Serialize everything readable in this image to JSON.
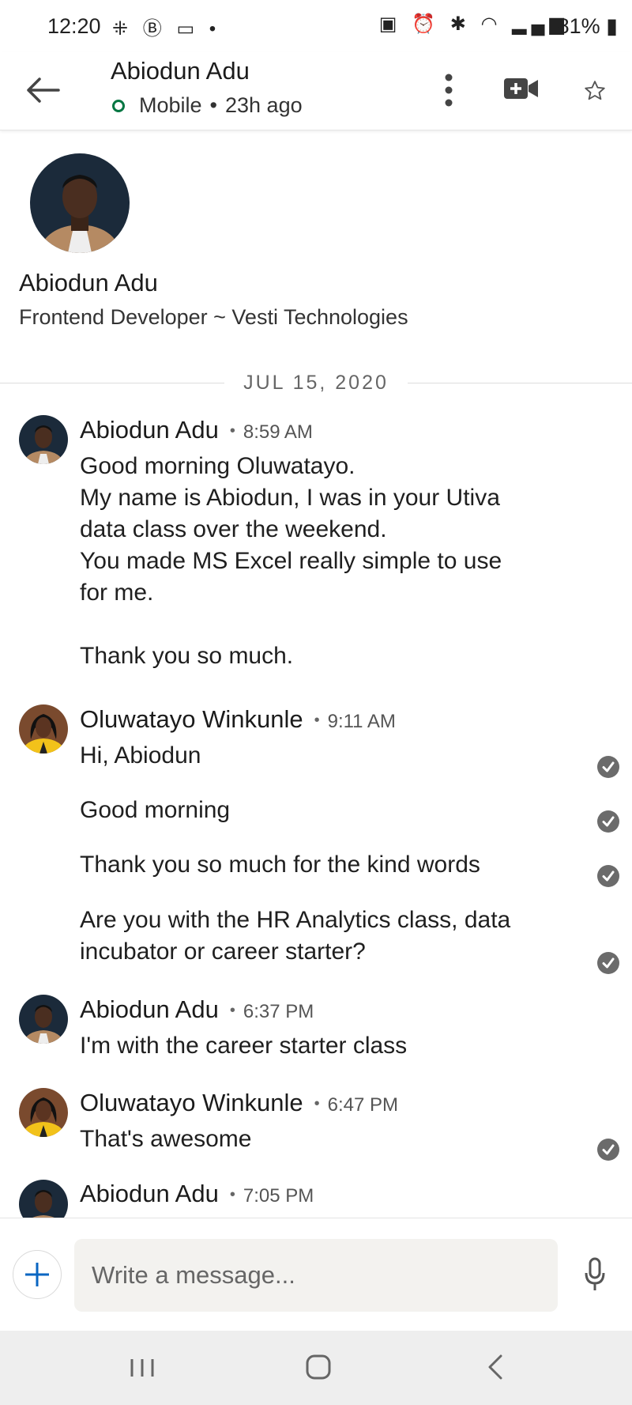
{
  "status_bar": {
    "time": "12:20",
    "battery": "81%"
  },
  "header": {
    "name": "Abiodun Adu",
    "presence": "Mobile",
    "separator": "•",
    "last_seen": "23h ago"
  },
  "profile": {
    "name": "Abiodun Adu",
    "headline": "Frontend Developer ~ Vesti Technologies"
  },
  "date_divider": "JUL 15, 2020",
  "colors": {
    "presence_green": "#057642",
    "accent_blue": "#0a66c2",
    "check_gray": "#6b6b6b"
  },
  "messages": [
    {
      "sender": "Abiodun Adu",
      "time": "8:59 AM",
      "lines": [
        "Good morning Oluwatayo.",
        "My name is Abiodun, I was in your Utiva",
        "data class over the weekend.",
        "You made MS Excel really simple to use",
        "for me.",
        "",
        "Thank you so much."
      ]
    },
    {
      "sender": "Oluwatayo Winkunle",
      "time": "9:11 AM",
      "bubbles": [
        "Hi, Abiodun",
        "Good morning",
        "Thank you so much for the kind words",
        "Are you with the HR Analytics class, data incubator or career starter?"
      ]
    },
    {
      "sender": "Abiodun Adu",
      "time": "6:37 PM",
      "text": "I'm with the career starter class"
    },
    {
      "sender": "Oluwatayo Winkunle",
      "time": "6:47 PM",
      "text": "That's awesome"
    },
    {
      "sender": "Abiodun Adu",
      "time": "7:05 PM"
    }
  ],
  "composer": {
    "placeholder": "Write a message..."
  },
  "icons": [
    "back-arrow-icon",
    "more-vertical-icon",
    "video-add-icon",
    "star-icon",
    "plus-icon",
    "mic-icon",
    "read-check-icon"
  ]
}
